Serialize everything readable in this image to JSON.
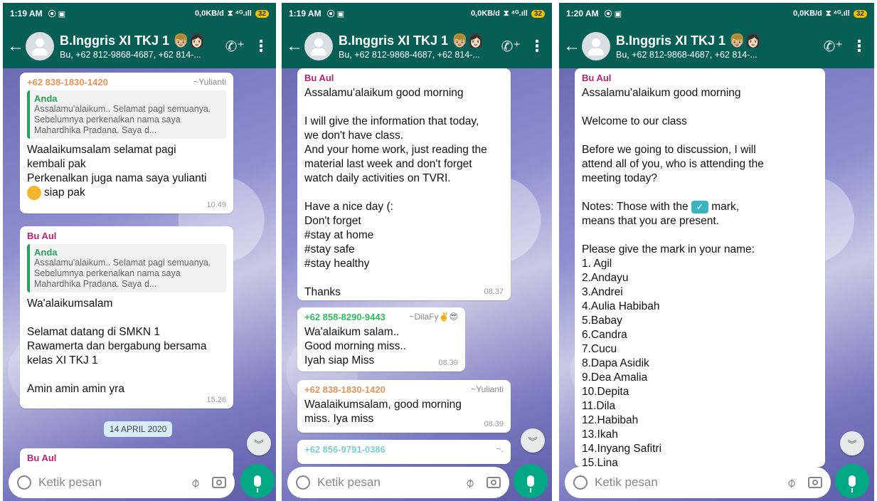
{
  "panels": [
    {
      "status": {
        "time": "1:19 AM",
        "icons": "⦿ ▣",
        "net": "0,0KB/d",
        "signal": "⧗ ⁴ᴳ.ıll",
        "battery": "32"
      },
      "header": {
        "title": "B.Inggris XI TKJ 1",
        "title_emoji": "👦🏼👩🏻",
        "subtitle": "Bu, +62 812-9868-4687, +62 814-..."
      },
      "input_placeholder": "Ketik pesan",
      "date_chip": "14 APRIL 2020",
      "messages": [
        {
          "sender": "+62 838-1830-1420",
          "nick": "~Yulianti",
          "quote_name": "Anda",
          "quote_text": "Assalamu'alaikum..  Selamat pagi semuanya. Sebelumnya perkenalkan nama saya Mahardhika Pradana. Saya d...",
          "text": "Waalaikumsalam selamat pagi\nkembali pak\nPerkenalkan juga nama saya yulianti",
          "text2": "siap pak",
          "time": "10.49"
        },
        {
          "sender": "Bu Aul",
          "quote_name": "Anda",
          "quote_text": "Assalamu'alaikum..  Selamat pagi semuanya. Sebelumnya perkenalkan nama saya Mahardhika Pradana. Saya d...",
          "text": "Wa'alaikumsalam\n\nSelamat datang di SMKN 1\nRawamerta dan bergabung bersama\nkelas XI TKJ 1\n\nAmin amin amin yra",
          "time": "15.26"
        },
        {
          "sender": "Bu Aul"
        }
      ]
    },
    {
      "status": {
        "time": "1:19 AM",
        "icons": "⦿ ▣",
        "net": "0,0KB/d",
        "signal": "⧗ ⁴ᴳ.ıll",
        "battery": "32"
      },
      "header": {
        "title": "B.Inggris XI TKJ 1",
        "title_emoji": "👦🏼👩🏻",
        "subtitle": "Bu, +62 812-9868-4687, +62 814-..."
      },
      "input_placeholder": "Ketik pesan",
      "messages": [
        {
          "sender": "Bu Aul",
          "text": "Assalamu'alaikum good morning\n\nI will give the information that today,\nwe don't have class.\nAnd your home work, just reading the\nmaterial last week and don't forget\nwatch daily activities on TVRI.\n\nHave a nice day (:\nDon't forget\n#stay at home\n#stay safe\n#stay healthy\n\nThanks",
          "time": "08.37"
        },
        {
          "sender": "+62 858-8290-9443",
          "nick": "~DilaFy✌️😎",
          "text": "Wa'alaikum salam..\nGood morning miss..\nIyah siap Miss",
          "time": "08.39"
        },
        {
          "sender": "+62 838-1830-1420",
          "nick": "~Yulianti",
          "text": "Waalaikumsalam, good morning\nmiss. Iya miss",
          "time": "08.39"
        },
        {
          "sender": "+62 856-9791-0386",
          "nick": "~."
        }
      ]
    },
    {
      "status": {
        "time": "1:20 AM",
        "icons": "⦿ ▣",
        "net": "0,0KB/d",
        "signal": "⧗ ⁴ᴳ.ıll",
        "battery": "32"
      },
      "header": {
        "title": "B.Inggris XI TKJ 1",
        "title_emoji": "👦🏼👩🏻",
        "subtitle": "Bu, +62 812-9868-4687, +62 814-..."
      },
      "input_placeholder": "Ketik pesan",
      "messages": [
        {
          "sender": "Bu Aul",
          "text_a": "Assalamu'alaikum good morning\n\nWelcome to our class\n\nBefore we going to discussion, I will\nattend all of you, who is attending the\nmeeting today?\n\nNotes: Those with the",
          "text_b": "mark,\nmeans that you are present.\n\nPlease give the mark in your name:\n1. Agil\n2.Andayu\n3.Andrei\n4.Aulia Habibah\n5.Babay\n6.Candra\n7.Cucu\n8.Dapa Asidik\n9.Dea Amalia\n10.Depita\n11.Dila\n12.Habibah\n13.Ikah\n14.Inyang Safitri\n15.Lina"
        }
      ]
    }
  ]
}
